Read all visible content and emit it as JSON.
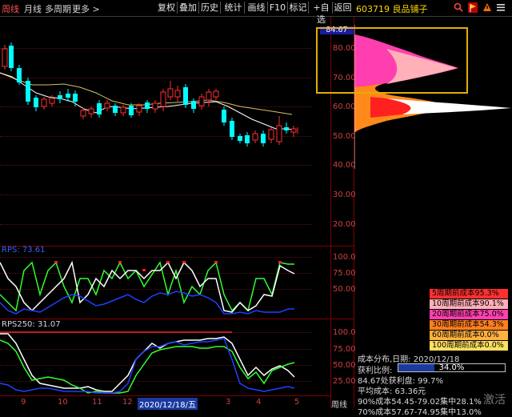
{
  "topbar": {
    "tabs": [
      "周线",
      "月线",
      "多周期",
      "更多 >"
    ],
    "buttons": [
      "复权",
      "叠加",
      "历史",
      "统计",
      "画线",
      "F10",
      "标记",
      "+自选",
      "返回"
    ],
    "stock_title": "603719 良品铺子",
    "window_title_colors": {
      "active": "#ff5050"
    }
  },
  "price_axis": {
    "labels": [
      "80.00",
      "70.00",
      "60.00",
      "50.00",
      "40.00",
      "30.00",
      "20.00"
    ],
    "marker": "84.67"
  },
  "indicator1": {
    "title_prefix": "RPS: 73.61",
    "axis": [
      "100.0",
      "75.00",
      "50.00"
    ]
  },
  "indicator2": {
    "title": "RPS250: 31.07",
    "axis": [
      "100.0",
      "75.00",
      "50.00",
      "25.00"
    ]
  },
  "date_axis": {
    "labels": [
      "9",
      "10",
      "11",
      "12",
      "2020/12/18/五",
      "3",
      "4",
      "5"
    ],
    "highlight_index": 4
  },
  "period_label": "周线",
  "cost_legend": [
    {
      "label": "5周期前成本95.3%",
      "color": "#ff3030"
    },
    {
      "label": "10周期前成本90.1%",
      "color": "#ffb0b8"
    },
    {
      "label": "20周期前成本75.0%",
      "color": "#ff40b0"
    },
    {
      "label": "30周期前成本54.3%",
      "color": "#ff8020"
    },
    {
      "label": "60周期前成本0.0%",
      "color": "#ffb040"
    },
    {
      "label": "100周期前成本0.0%",
      "color": "#ffe060"
    }
  ],
  "info": {
    "dist_date": "成本分布,日期:  2020/12/18",
    "profit_label": "获利比例:",
    "profit_value": "34.0%",
    "profit_fill": 0.34,
    "line3": "84.67处获利盘:  99.7%",
    "line4": "平均成本:  63.36元",
    "line5": "90%成本54.45-79.02集中28.1%",
    "line6": "70%成本57.67-74.95集中13.0%"
  },
  "watermark": "激活"
}
